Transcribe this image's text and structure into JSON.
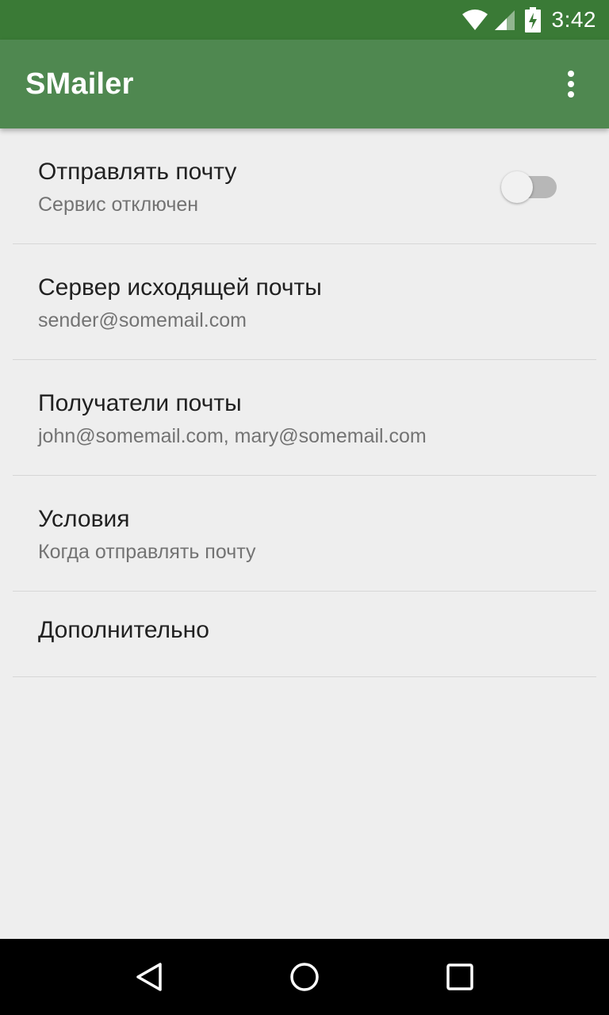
{
  "status_bar": {
    "time": "3:42",
    "icons": [
      "wifi-icon",
      "signal-icon",
      "battery-charging-icon"
    ],
    "background": "#3a7a36"
  },
  "app_bar": {
    "title": "SMailer",
    "background": "#4f8850",
    "overflow_icon": "more-vert-icon"
  },
  "preferences": [
    {
      "title": "Отправлять почту",
      "summary": "Сервис отключен",
      "toggle": false
    },
    {
      "title": "Сервер исходящей почты",
      "summary": "sender@somemail.com"
    },
    {
      "title": "Получатели почты",
      "summary": "john@somemail.com, mary@somemail.com"
    },
    {
      "title": "Условия",
      "summary": "Когда отправлять почту"
    },
    {
      "title": "Дополнительно"
    }
  ],
  "nav_bar": {
    "icons": [
      "back-icon",
      "home-icon",
      "recents-icon"
    ]
  }
}
